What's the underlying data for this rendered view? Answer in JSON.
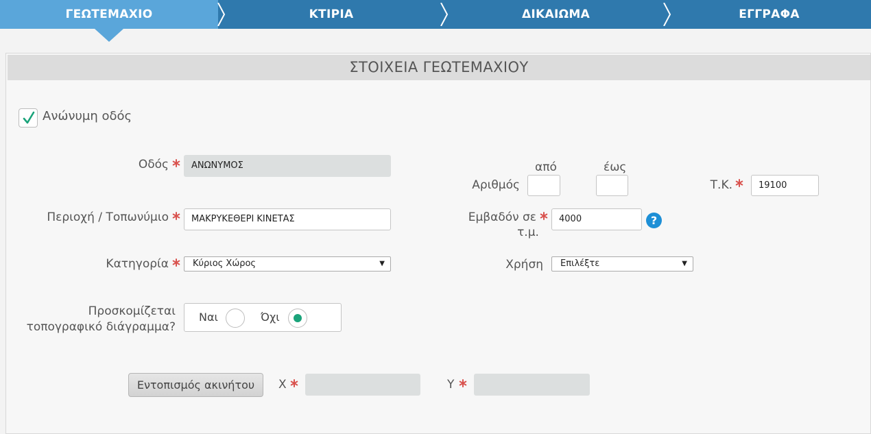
{
  "nav": {
    "steps": [
      {
        "label": "ΓΕΩΤΕΜΑΧΙΟ",
        "active": true
      },
      {
        "label": "ΚΤΙΡΙΑ",
        "active": false
      },
      {
        "label": "ΔΙΚΑΙΩΜΑ",
        "active": false
      },
      {
        "label": "ΕΓΓΡΑΦΑ",
        "active": false
      }
    ]
  },
  "panel": {
    "title": "ΣΤΟΙΧΕΙΑ ΓΕΩΤΕΜΑΧΙΟΥ"
  },
  "form": {
    "anonymous_street": {
      "label": "Ανώνυμη οδός",
      "checked": true
    },
    "street": {
      "label": "Οδός",
      "value": "ΑΝΩΝΥΜΟΣ"
    },
    "number": {
      "label": "Αριθμός",
      "from_label": "από",
      "to_label": "έως",
      "from_value": "",
      "to_value": ""
    },
    "postal_code": {
      "label": "Τ.Κ.",
      "value": "19100"
    },
    "area": {
      "label": "Περιοχή / Τοπωνύμιο",
      "value": "ΜΑΚΡΥΚΕΘΕΡΙ ΚΙΝΕΤΑΣ"
    },
    "surface": {
      "label_line1": "Εμβαδόν σε",
      "label_line2": "τ.μ.",
      "value": "4000",
      "help": "?"
    },
    "category": {
      "label": "Κατηγορία",
      "selected": "Κύριος Χώρος"
    },
    "usage": {
      "label": "Χρήση",
      "selected": "Επιλέξτε"
    },
    "topo_diagram": {
      "label_line1": "Προσκομίζεται",
      "label_line2": "τοπογραφικό διάγραμμα?",
      "yes_label": "Ναι",
      "no_label": "Όχι",
      "selected": "no"
    },
    "locate_button": "Εντοπισμός ακινήτου",
    "x": {
      "label": "X",
      "value": ""
    },
    "y": {
      "label": "Y",
      "value": ""
    }
  },
  "colors": {
    "nav_bg": "#2f79ad",
    "nav_active": "#5aa6da",
    "required": "#d9534f",
    "radio_selected": "#1aa37a",
    "help_icon": "#1d8fd6"
  }
}
